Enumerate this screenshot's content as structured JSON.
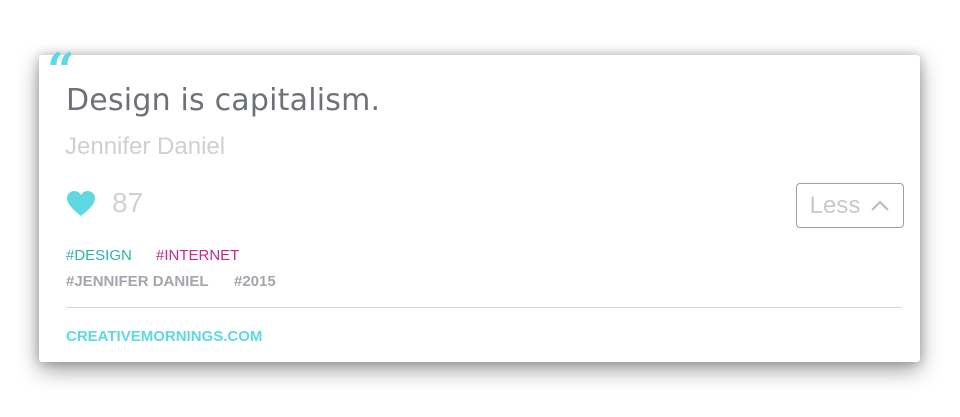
{
  "quote": {
    "mark": "“",
    "text": "Design is capitalism.",
    "author": "Jennifer Daniel"
  },
  "likes": {
    "icon": "heart-icon",
    "count": "87",
    "icon_color": "#5ed9e3"
  },
  "toggle": {
    "label": "Less",
    "icon": "chevron-up-icon"
  },
  "tags": {
    "design": "#DESIGN",
    "internet": "#INTERNET",
    "speaker": "#JENNIFER DANIEL",
    "year": "#2015"
  },
  "footer": {
    "link": "CREATIVEMORNINGS.COM"
  },
  "colors": {
    "accent": "#5ed9e3",
    "tag_design": "#2bb5a8",
    "tag_internet": "#c22a90",
    "tag_muted": "#a4a6ab",
    "quote_text": "#6e7177"
  }
}
